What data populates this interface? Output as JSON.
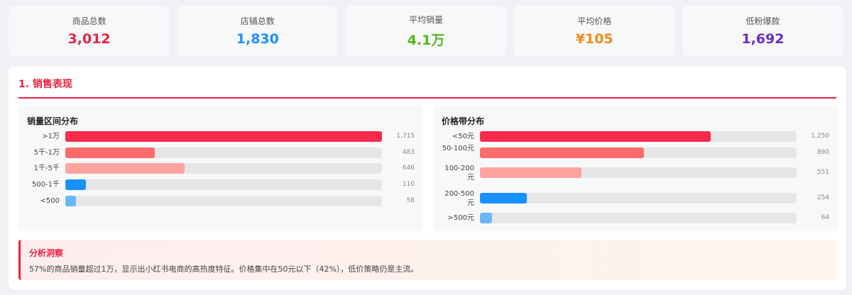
{
  "stats": [
    {
      "label": "商品总数",
      "value": "3,012",
      "color": "#e8233f"
    },
    {
      "label": "店铺总数",
      "value": "1,830",
      "color": "#1e90ff"
    },
    {
      "label": "平均销量",
      "value": "4.1万",
      "color": "#52b81a"
    },
    {
      "label": "平均价格",
      "value": "¥105",
      "color": "#f08c1e"
    },
    {
      "label": "低粉爆款",
      "value": "1,692",
      "color": "#6a2fc2"
    }
  ],
  "section": {
    "title": "1. 销售表现"
  },
  "sales_distribution": {
    "title": "销量区间分布",
    "max": 1715,
    "items": [
      {
        "label": ">1万",
        "value": 1715,
        "display": "1,715",
        "color": "#fa2a4b"
      },
      {
        "label": "5千-1万",
        "value": 483,
        "display": "483",
        "color": "#ff6b6b"
      },
      {
        "label": "1千-5千",
        "value": 646,
        "display": "646",
        "color": "#ffa39e"
      },
      {
        "label": "500-1千",
        "value": 110,
        "display": "110",
        "color": "#1890ff"
      },
      {
        "label": "<500",
        "value": 58,
        "display": "58",
        "color": "#69b7f5"
      }
    ]
  },
  "price_distribution": {
    "title": "价格带分布",
    "max": 1715,
    "items": [
      {
        "label": "<50元",
        "value": 1250,
        "display": "1,250",
        "color": "#fa2a4b"
      },
      {
        "label": "50-100元",
        "value": 890,
        "display": "890",
        "color": "#ff6b6b"
      },
      {
        "label": "100-200元",
        "value": 551,
        "display": "551",
        "color": "#ffa39e"
      },
      {
        "label": "200-500元",
        "value": 254,
        "display": "254",
        "color": "#1890ff"
      },
      {
        "label": ">500元",
        "value": 64,
        "display": "64",
        "color": "#69b7f5"
      }
    ]
  },
  "insight": {
    "title": "分析洞察",
    "text": "57%的商品销量超过1万，显示出小红书电商的高热度特征。价格集中在50元以下（42%），低价策略仍是主流。"
  }
}
